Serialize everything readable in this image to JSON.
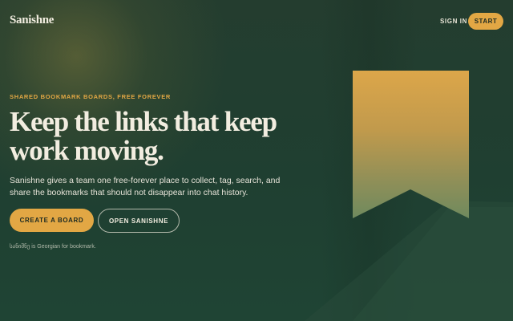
{
  "header": {
    "logo": "Sanishne",
    "sign_in": "SIGN IN",
    "start": "START"
  },
  "hero": {
    "eyebrow": "SHARED BOOKMARK BOARDS, FREE FOREVER",
    "headline_line1": "Keep the links that keep",
    "headline_line2": "work moving.",
    "description": "Sanishne gives a team one free-forever place to collect, tag, search, and share the bookmarks that should not disappear into chat history.",
    "primary_cta": "CREATE A BOARD",
    "secondary_cta": "OPEN SANISHNE",
    "footnote": "სანიშნე is Georgian for bookmark."
  },
  "colors": {
    "accent": "#e2a744",
    "background": "#1f3a2e",
    "text_light": "#f2ede0"
  },
  "icons": {
    "hero_graphic": "bookmark-ribbon-icon"
  }
}
